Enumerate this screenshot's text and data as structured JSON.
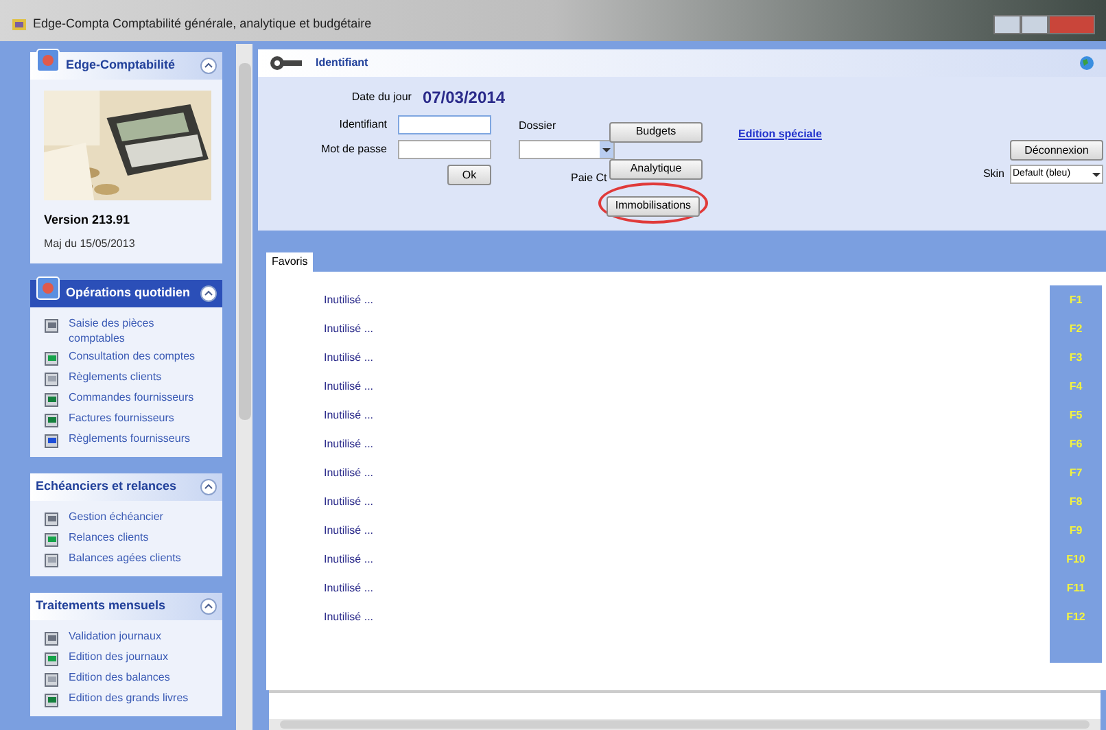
{
  "window": {
    "title": "Edge-Compta Comptabilité générale, analytique et budgétaire"
  },
  "sidebar": {
    "panels": [
      {
        "kind": "info",
        "title": "Edge-Comptabilité",
        "version": "Version 213.91",
        "updated": "Maj du 15/05/2013",
        "expanded": true
      },
      {
        "kind": "list",
        "title": "Opérations quotidien",
        "highlighted": true,
        "items": [
          "Saisie des pièces comptables",
          "Consultation des comptes",
          "Règlements clients",
          "Commandes fournisseurs",
          "Factures fournisseurs",
          "Règlements fournisseurs"
        ]
      },
      {
        "kind": "list",
        "title": "Echéanciers et relances",
        "highlighted": false,
        "items": [
          "Gestion échéancier",
          "Relances clients",
          "Balances agées clients"
        ]
      },
      {
        "kind": "list",
        "title": "Traitements mensuels",
        "highlighted": false,
        "items": [
          "Validation journaux",
          "Edition des journaux",
          "Edition des balances",
          "Edition des grands livres"
        ]
      }
    ]
  },
  "login": {
    "title": "Identifiant",
    "date_label": "Date du jour",
    "date": "07/03/2014",
    "id_label": "Identifiant",
    "password_label": "Mot de passe",
    "ok": "Ok",
    "dossier_label": "Dossier",
    "buttons": [
      "Budgets",
      "Analytique",
      "Immobilisations"
    ],
    "paie_label": "Paie Ct",
    "special_link": "Edition spéciale",
    "logout": "Déconnexion",
    "skin_label": "Skin",
    "skin_value": "Default (bleu)"
  },
  "tabs": [
    {
      "label": "Favoris",
      "selected": true
    }
  ],
  "favorites": [
    {
      "label": "Inutilisé ...",
      "key": "F1"
    },
    {
      "label": "Inutilisé ...",
      "key": "F2"
    },
    {
      "label": "Inutilisé ...",
      "key": "F3"
    },
    {
      "label": "Inutilisé ...",
      "key": "F4"
    },
    {
      "label": "Inutilisé ...",
      "key": "F5"
    },
    {
      "label": "Inutilisé ...",
      "key": "F6"
    },
    {
      "label": "Inutilisé ...",
      "key": "F7"
    },
    {
      "label": "Inutilisé ...",
      "key": "F8"
    },
    {
      "label": "Inutilisé ...",
      "key": "F9"
    },
    {
      "label": "Inutilisé ...",
      "key": "F10"
    },
    {
      "label": "Inutilisé ...",
      "key": "F11"
    },
    {
      "label": "Inutilisé ...",
      "key": "F12"
    }
  ]
}
